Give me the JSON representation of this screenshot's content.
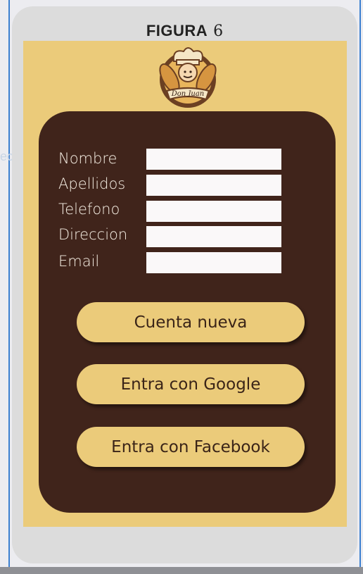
{
  "figure": {
    "word": "FIGURA",
    "number": "6"
  },
  "logo": {
    "text": "Don Juan"
  },
  "form": {
    "fields": [
      {
        "label": "Nombre",
        "value": ""
      },
      {
        "label": "Apellidos",
        "value": ""
      },
      {
        "label": "Telefono",
        "value": ""
      },
      {
        "label": "Direccion",
        "value": ""
      },
      {
        "label": "Email",
        "value": ""
      }
    ]
  },
  "actions": {
    "new_account": "Cuenta nueva",
    "google": "Entra con Google",
    "facebook": "Entra con Facebook"
  },
  "colors": {
    "screen_bg": "#ebcb7a",
    "card_bg": "#40241b",
    "button_bg": "#ebcb7a",
    "button_text": "#3a2418",
    "label_text": "#f6efe4",
    "frame_accent": "#3b7fd0"
  }
}
